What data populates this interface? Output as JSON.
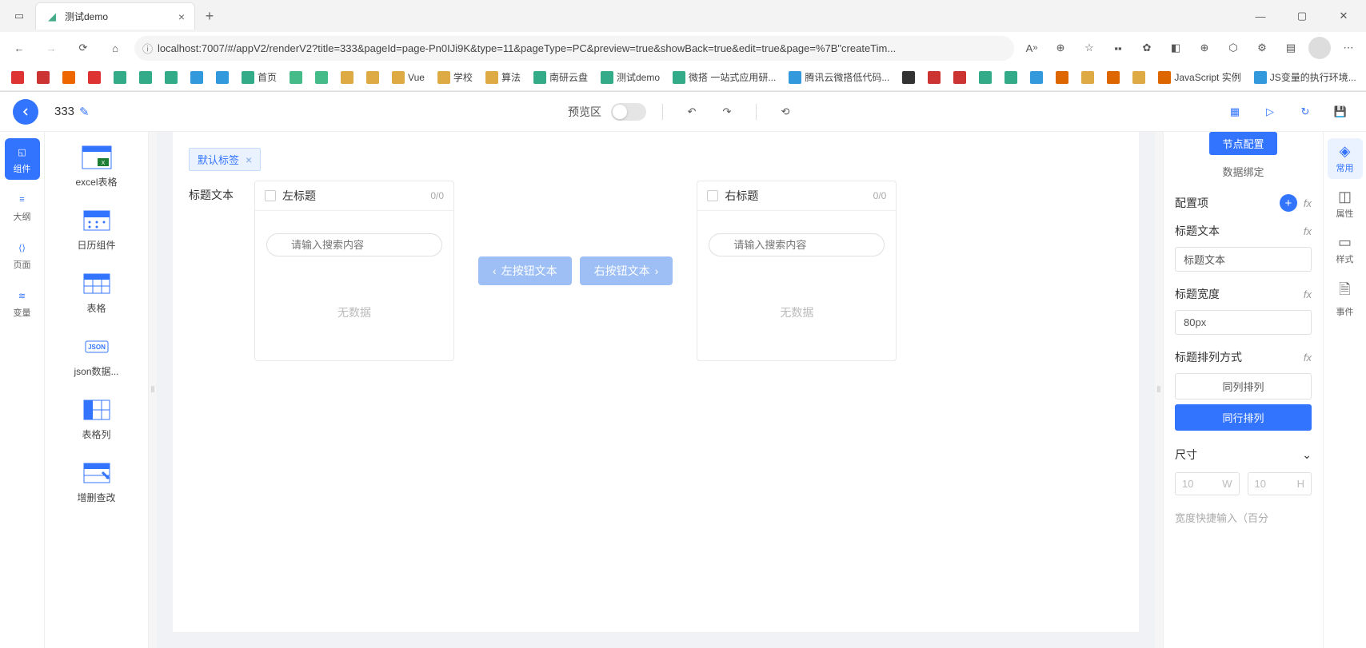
{
  "browser": {
    "tab_title": "测试demo",
    "url": "localhost:7007/#/appV2/renderV2?title=333&pageId=page-Pn0IJi9K&type=11&pageType=PC&preview=true&showBack=true&edit=true&page=%7B\"createTim...",
    "bookmarks": [
      {
        "label": "",
        "color": "#d33"
      },
      {
        "label": "",
        "color": "#c33"
      },
      {
        "label": "",
        "color": "#e60"
      },
      {
        "label": "",
        "color": "#d33"
      },
      {
        "label": "",
        "color": "#3a8"
      },
      {
        "label": "",
        "color": "#3a8"
      },
      {
        "label": "",
        "color": "#3a8"
      },
      {
        "label": "",
        "color": "#39d"
      },
      {
        "label": "",
        "color": "#39d"
      },
      {
        "label": "首页",
        "color": "#3a8"
      },
      {
        "label": "",
        "color": "#4b8"
      },
      {
        "label": "",
        "color": "#4b8"
      },
      {
        "label": "",
        "color": "#da4"
      },
      {
        "label": "",
        "color": "#da4"
      },
      {
        "label": "Vue",
        "color": "#da4"
      },
      {
        "label": "学校",
        "color": "#da4"
      },
      {
        "label": "算法",
        "color": "#da4"
      },
      {
        "label": "南研云盘",
        "color": "#3a8"
      },
      {
        "label": "测试demo",
        "color": "#3a8"
      },
      {
        "label": "微搭 一站式应用研...",
        "color": "#3a8"
      },
      {
        "label": "腾讯云微搭低代码...",
        "color": "#39d"
      },
      {
        "label": "",
        "color": "#333"
      },
      {
        "label": "",
        "color": "#c33"
      },
      {
        "label": "",
        "color": "#c33"
      },
      {
        "label": "",
        "color": "#3a8"
      },
      {
        "label": "",
        "color": "#3a8"
      },
      {
        "label": "",
        "color": "#39d"
      },
      {
        "label": "",
        "color": "#d60"
      },
      {
        "label": "",
        "color": "#da4"
      },
      {
        "label": "",
        "color": "#d60"
      },
      {
        "label": "",
        "color": "#da4"
      },
      {
        "label": "JavaScript 实例",
        "color": "#d60"
      },
      {
        "label": "JS变量的执行环境...",
        "color": "#39d"
      }
    ]
  },
  "header": {
    "page_name": "333",
    "preview_label": "预览区"
  },
  "rail": [
    {
      "label": "组件",
      "active": true
    },
    {
      "label": "大纲",
      "active": false
    },
    {
      "label": "页面",
      "active": false
    },
    {
      "label": "变量",
      "active": false
    }
  ],
  "components": [
    {
      "label": "excel表格"
    },
    {
      "label": "日历组件"
    },
    {
      "label": "表格"
    },
    {
      "label": "json数据..."
    },
    {
      "label": "表格列"
    },
    {
      "label": "增删查改"
    }
  ],
  "canvas": {
    "default_tag": "默认标签",
    "row_label": "标题文本",
    "left": {
      "title": "左标题",
      "count": "0/0",
      "placeholder": "请输入搜索内容",
      "empty": "无数据"
    },
    "right": {
      "title": "右标题",
      "count": "0/0",
      "placeholder": "请输入搜索内容",
      "empty": "无数据"
    },
    "btn_left": "左按钮文本",
    "btn_right": "右按钮文本"
  },
  "config": {
    "tabs": [
      {
        "label": "节点配置",
        "active": true
      },
      {
        "label": "数据绑定",
        "active": false
      }
    ],
    "section1": "配置项",
    "title_text_label": "标题文本",
    "title_text_value": "标题文本",
    "title_width_label": "标题宽度",
    "title_width_value": "80px",
    "layout_label": "标题排列方式",
    "layout_options": [
      {
        "label": "同列排列",
        "active": false
      },
      {
        "label": "同行排列",
        "active": true
      }
    ],
    "size_label": "尺寸",
    "size_w": "10",
    "size_h": "10",
    "size_w_unit": "W",
    "size_h_unit": "H",
    "footer_label": "宽度快捷输入（百分"
  },
  "right_rail": [
    {
      "label": "常用",
      "active": true
    },
    {
      "label": "属性",
      "active": false
    },
    {
      "label": "样式",
      "active": false
    },
    {
      "label": "事件",
      "active": false
    }
  ]
}
